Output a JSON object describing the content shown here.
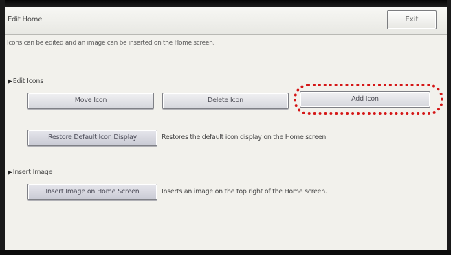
{
  "header": {
    "title": "Edit Home",
    "exit_label": "Exit"
  },
  "description": "Icons can be edited and an image can be inserted on the Home screen.",
  "edit_icons": {
    "heading": "Edit Icons",
    "move_label": "Move Icon",
    "delete_label": "Delete Icon",
    "add_label": "Add Icon",
    "restore_label": "Restore Default Icon Display",
    "restore_description": "Restores the default icon display on the Home screen."
  },
  "insert_image": {
    "heading": "Insert Image",
    "insert_label": "Insert Image on Home Screen",
    "insert_description": "Inserts an image on the top right of the Home screen."
  },
  "annotation": {
    "highlight_color": "#d41616",
    "highlighted_item": "Add Icon"
  },
  "icons": {
    "section_arrow": "triangle-right-icon"
  }
}
